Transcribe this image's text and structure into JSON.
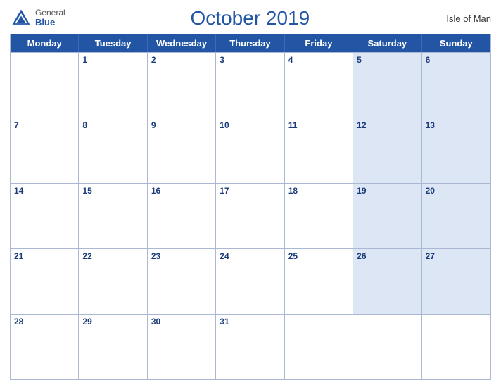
{
  "header": {
    "logo_general": "General",
    "logo_blue": "Blue",
    "title": "October 2019",
    "region": "Isle of Man"
  },
  "days_of_week": [
    "Monday",
    "Tuesday",
    "Wednesday",
    "Thursday",
    "Friday",
    "Saturday",
    "Sunday"
  ],
  "weeks": [
    [
      {
        "day": "",
        "weekend": false,
        "empty": true
      },
      {
        "day": "1",
        "weekend": false
      },
      {
        "day": "2",
        "weekend": false
      },
      {
        "day": "3",
        "weekend": false
      },
      {
        "day": "4",
        "weekend": false
      },
      {
        "day": "5",
        "weekend": true
      },
      {
        "day": "6",
        "weekend": true
      }
    ],
    [
      {
        "day": "7",
        "weekend": false
      },
      {
        "day": "8",
        "weekend": false
      },
      {
        "day": "9",
        "weekend": false
      },
      {
        "day": "10",
        "weekend": false
      },
      {
        "day": "11",
        "weekend": false
      },
      {
        "day": "12",
        "weekend": true
      },
      {
        "day": "13",
        "weekend": true
      }
    ],
    [
      {
        "day": "14",
        "weekend": false
      },
      {
        "day": "15",
        "weekend": false
      },
      {
        "day": "16",
        "weekend": false
      },
      {
        "day": "17",
        "weekend": false
      },
      {
        "day": "18",
        "weekend": false
      },
      {
        "day": "19",
        "weekend": true
      },
      {
        "day": "20",
        "weekend": true
      }
    ],
    [
      {
        "day": "21",
        "weekend": false
      },
      {
        "day": "22",
        "weekend": false
      },
      {
        "day": "23",
        "weekend": false
      },
      {
        "day": "24",
        "weekend": false
      },
      {
        "day": "25",
        "weekend": false
      },
      {
        "day": "26",
        "weekend": true
      },
      {
        "day": "27",
        "weekend": true
      }
    ],
    [
      {
        "day": "28",
        "weekend": false
      },
      {
        "day": "29",
        "weekend": false
      },
      {
        "day": "30",
        "weekend": false
      },
      {
        "day": "31",
        "weekend": false
      },
      {
        "day": "",
        "weekend": false,
        "empty": true
      },
      {
        "day": "",
        "weekend": true,
        "empty": true
      },
      {
        "day": "",
        "weekend": true,
        "empty": true
      }
    ]
  ]
}
